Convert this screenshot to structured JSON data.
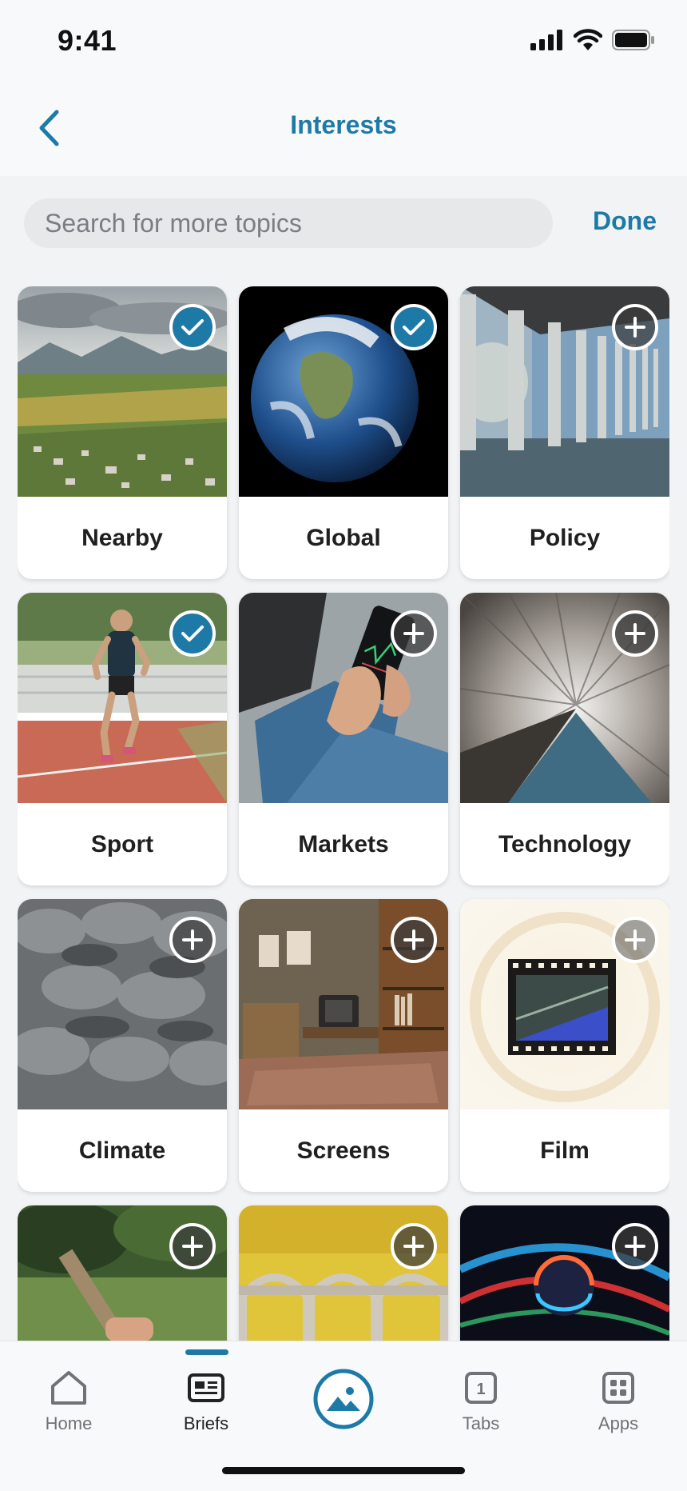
{
  "status_bar": {
    "time": "9:41"
  },
  "nav": {
    "title": "Interests"
  },
  "search": {
    "placeholder": "Search for more topics",
    "done_label": "Done"
  },
  "topics": [
    {
      "label": "Nearby",
      "selected": true
    },
    {
      "label": "Global",
      "selected": true
    },
    {
      "label": "Policy",
      "selected": false
    },
    {
      "label": "Sport",
      "selected": true
    },
    {
      "label": "Markets",
      "selected": false
    },
    {
      "label": "Technology",
      "selected": false
    },
    {
      "label": "Climate",
      "selected": false
    },
    {
      "label": "Screens",
      "selected": false
    },
    {
      "label": "Film",
      "selected": false
    },
    {
      "label": "",
      "selected": false
    },
    {
      "label": "",
      "selected": false
    },
    {
      "label": "",
      "selected": false
    }
  ],
  "tab_bar": {
    "tabs": [
      {
        "label": "Home",
        "icon": "house-icon"
      },
      {
        "label": "Briefs",
        "icon": "briefs-icon"
      },
      {
        "label": "",
        "icon": "image-mountain-icon"
      },
      {
        "label": "Tabs",
        "icon": "tabs-count-icon",
        "count": "1"
      },
      {
        "label": "Apps",
        "icon": "apps-grid-icon"
      }
    ],
    "active": "Briefs"
  },
  "colors": {
    "accent": "#1d7aa6",
    "background": "#f2f3f5"
  }
}
